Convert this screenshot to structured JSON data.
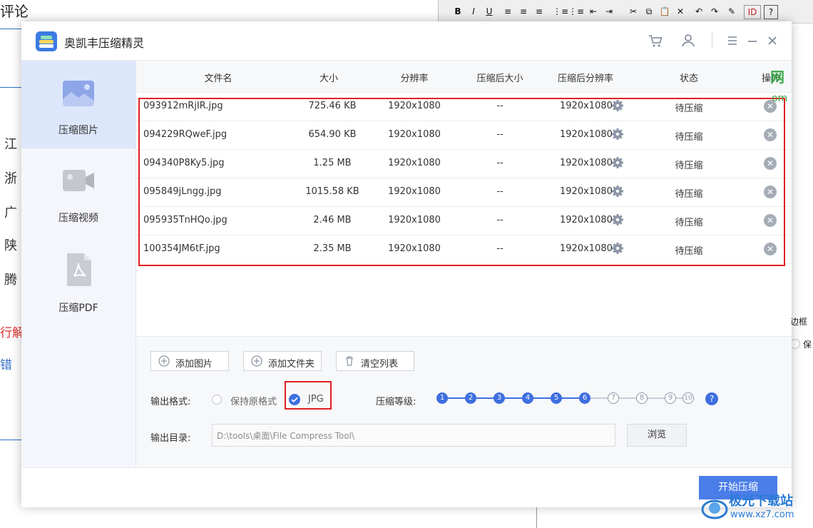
{
  "background": {
    "title": "评论",
    "items": [
      "江",
      "浙",
      "广",
      "陕",
      "腾"
    ],
    "red_text": "行解",
    "blue_text": "错",
    "right_panel": [
      "边框",
      "保"
    ],
    "toolbar": [
      "B",
      "I",
      "U",
      "≡",
      "≡",
      "≡",
      "⋮≡",
      "⋮≡",
      "⇤",
      "⇥",
      "✂",
      "⧉",
      "📋",
      "✕",
      "↶",
      "↷",
      "✎",
      "ID",
      "?"
    ]
  },
  "app": {
    "title": "奥凯丰压缩精灵",
    "icons": [
      "cart-icon",
      "user-icon",
      "menu-icon",
      "minimize-icon",
      "close-icon"
    ]
  },
  "sidebar": {
    "items": [
      {
        "label": "压缩图片",
        "icon": "image-icon",
        "active": true
      },
      {
        "label": "压缩视频",
        "icon": "video-icon",
        "active": false
      },
      {
        "label": "压缩PDF",
        "icon": "pdf-icon",
        "active": false
      }
    ]
  },
  "table": {
    "headers": [
      "文件名",
      "大小",
      "分辨率",
      "压缩后大小",
      "压缩后分辨率",
      "状态",
      "操作"
    ],
    "rows": [
      {
        "name": "093912mRjIR.jpg",
        "size": "725.46 KB",
        "res": "1920x1080",
        "out_size": "--",
        "out_res": "1920x1080",
        "status": "待压缩"
      },
      {
        "name": "094229RQweF.jpg",
        "size": "654.90 KB",
        "res": "1920x1080",
        "out_size": "--",
        "out_res": "1920x1080",
        "status": "待压缩"
      },
      {
        "name": "094340P8Ky5.jpg",
        "size": "1.25 MB",
        "res": "1920x1080",
        "out_size": "--",
        "out_res": "1920x1080",
        "status": "待压缩"
      },
      {
        "name": "095849jLngg.jpg",
        "size": "1015.58 KB",
        "res": "1920x1080",
        "out_size": "--",
        "out_res": "1920x1080",
        "status": "待压缩"
      },
      {
        "name": "095935TnHQo.jpg",
        "size": "2.46 MB",
        "res": "1920x1080",
        "out_size": "--",
        "out_res": "1920x1080",
        "status": "待压缩"
      },
      {
        "name": "100354JM6tF.jpg",
        "size": "2.35 MB",
        "res": "1920x1080",
        "out_size": "--",
        "out_res": "1920x1080",
        "status": "待压缩"
      }
    ]
  },
  "actions": {
    "add_images": "添加图片",
    "add_folder": "添加文件夹",
    "clear_list": "清空列表"
  },
  "output": {
    "format_label": "输出格式:",
    "keep_format": "保持原格式",
    "jpg": "JPG",
    "selected_format": "JPG",
    "level_label": "压缩等级:",
    "levels": [
      "1",
      "2",
      "3",
      "4",
      "5",
      "6",
      "7",
      "8",
      "9",
      "10"
    ],
    "selected_level": 6,
    "dir_label": "输出目录:",
    "dir_value": "D:\\tools\\桌面\\File Compress Tool\\",
    "browse": "浏览",
    "start": "开始压缩"
  },
  "watermark": {
    "name": "极光下载站",
    "url": "www.xz7.com",
    "edge_char": "网",
    "edge_suffix": "om"
  },
  "colors": {
    "accent": "#3e6fe0",
    "highlight_box": "#e02020",
    "sidebar_active": "#dde7fb"
  }
}
